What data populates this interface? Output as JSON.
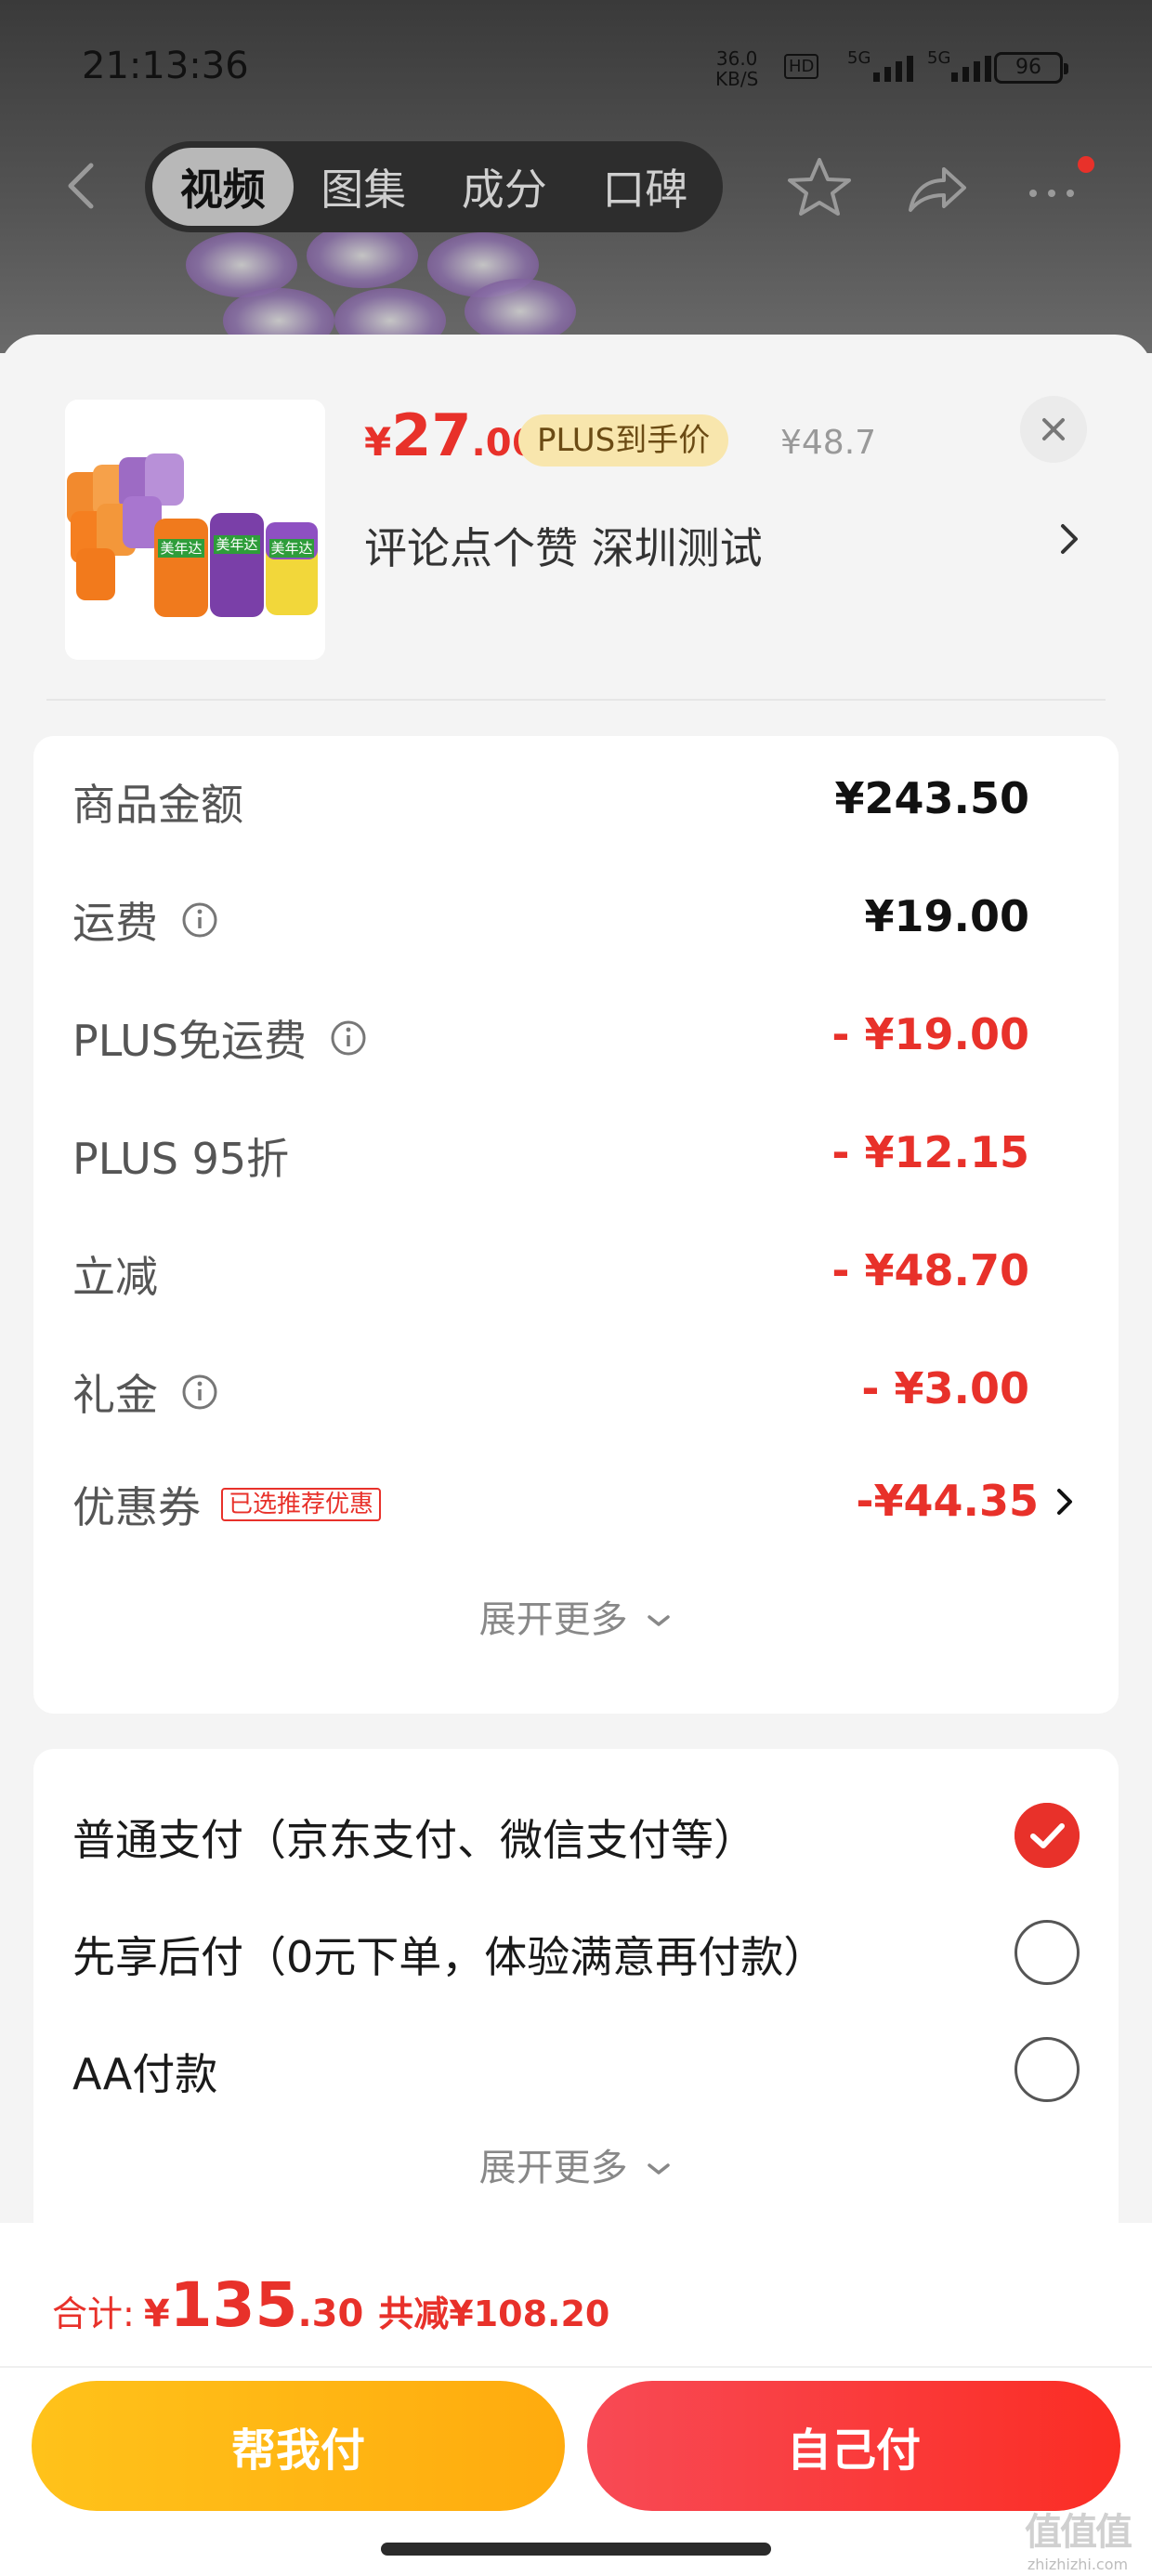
{
  "status_bar": {
    "time": "21:13:36",
    "net_speed_value": "36.0",
    "net_speed_unit": "KB/S",
    "hd": "HD",
    "network1": "5G",
    "network2": "5G",
    "battery": "96"
  },
  "nav": {
    "tabs": [
      {
        "label": "视频",
        "active": true
      },
      {
        "label": "图集",
        "active": false
      },
      {
        "label": "成分",
        "active": false
      },
      {
        "label": "口碑",
        "active": false
      }
    ]
  },
  "product": {
    "price_symbol": "¥",
    "price_integer": "27",
    "price_decimal": ".06",
    "plus_badge": "PLUS到手价",
    "original_price": "¥48.7",
    "spec": "评论点个赞  深圳测试",
    "image_brand": "美年达"
  },
  "fees": {
    "rows": [
      {
        "label": "商品金额",
        "value": "¥243.50",
        "red": false,
        "info": false
      },
      {
        "label": "运费",
        "value": "¥19.00",
        "red": false,
        "info": true
      },
      {
        "label": "PLUS免运费",
        "value": "- ¥19.00",
        "red": true,
        "info": true
      },
      {
        "label": "PLUS 95折",
        "value": "- ¥12.15",
        "red": true,
        "info": false
      },
      {
        "label": "立减",
        "value": "- ¥48.70",
        "red": true,
        "info": false
      },
      {
        "label": "礼金",
        "value": "- ¥3.00",
        "red": true,
        "info": true
      }
    ],
    "coupon": {
      "label": "优惠券",
      "tag": "已选推荐优惠",
      "value": "-¥44.35"
    },
    "expand_label": "展开更多"
  },
  "payment": {
    "options": [
      {
        "label": "普通支付（京东支付、微信支付等）",
        "selected": true
      },
      {
        "label": "先享后付（0元下单，体验满意再付款）",
        "selected": false
      },
      {
        "label": "AA付款",
        "selected": false
      }
    ],
    "expand_label": "展开更多"
  },
  "footer": {
    "total_label": "合计:",
    "total_symbol": "¥",
    "total_integer": "135",
    "total_decimal": ".30",
    "saved": "共减¥108.20",
    "help_pay_label": "帮我付",
    "self_pay_label": "自己付"
  },
  "watermark": {
    "mark": "值值值",
    "url": "zhizhizhi.com"
  },
  "colors": {
    "accent_red": "#e8312a",
    "help_pay_yellow": "#ffb814",
    "plus_gold": "#f8e6ad"
  }
}
